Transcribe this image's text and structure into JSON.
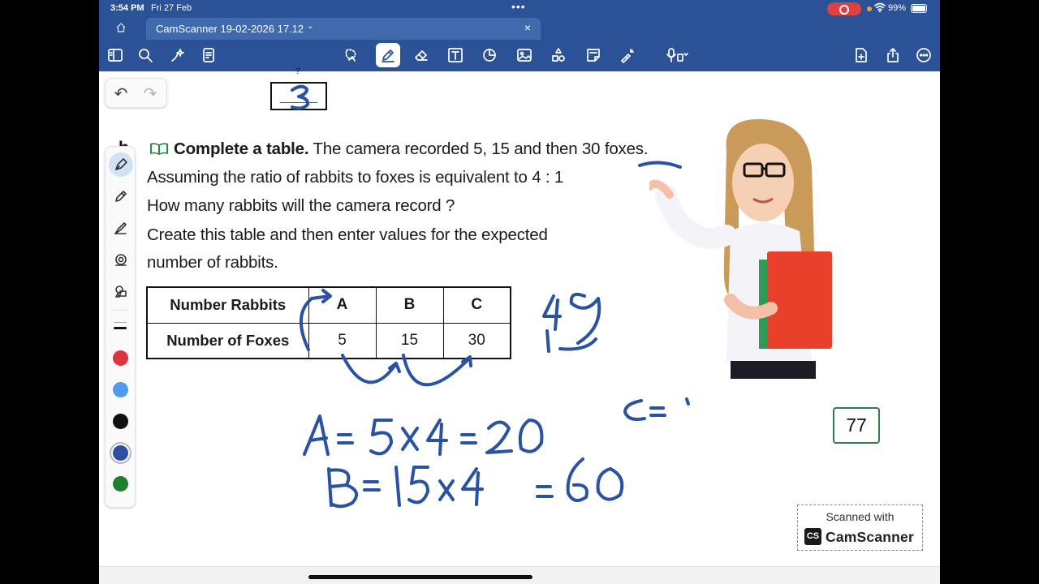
{
  "status_bar": {
    "time": "3:54 PM",
    "date": "Fri 27 Feb",
    "battery": "99%"
  },
  "tab": {
    "title": "CamScanner 19-02-2026 17.12"
  },
  "toolbar": {
    "icons": [
      "sidebar-icon",
      "search-icon",
      "magic-wand-icon",
      "document-icon",
      "lasso-icon",
      "pen-icon",
      "eraser-icon",
      "text-box-icon",
      "shapes-icon",
      "image-icon",
      "stickers-icon",
      "note-icon",
      "laser-pointer-icon",
      "microphone-icon",
      "add-page-icon",
      "share-icon",
      "more-icon"
    ]
  },
  "palette": {
    "colors": [
      "#e0323f",
      "#4f9bf0",
      "#111111",
      "#2d4fa0",
      "#1e7f2e"
    ],
    "selected_color": "#2d4fa0"
  },
  "worksheet": {
    "box_number": "3",
    "question_letter": "b",
    "line1_bold": "Complete a table.",
    "line1_rest": " The camera recorded 5, 15 and then 30 foxes.",
    "line2": "Assuming the ratio of rabbits to foxes is equivalent to 4 : 1",
    "line3": "How many rabbits will the camera record ?",
    "line4": "Create this table and then enter values for the expected",
    "line5": "number of rabbits.",
    "table": {
      "row1_header": "Number Rabbits",
      "row2_header": "Number of Foxes",
      "columns": [
        "A",
        "B",
        "C"
      ],
      "foxes": [
        "5",
        "15",
        "30"
      ]
    },
    "page_number": "77"
  },
  "handwriting": {
    "ratio": "4 : 1",
    "eq_a": "A = 5 x 4 = 20",
    "eq_b": "B = 15 x 4 = 60",
    "eq_c": "C ="
  },
  "watermark": {
    "line1": "Scanned with",
    "brand": "CamScanner",
    "logo": "CS"
  }
}
